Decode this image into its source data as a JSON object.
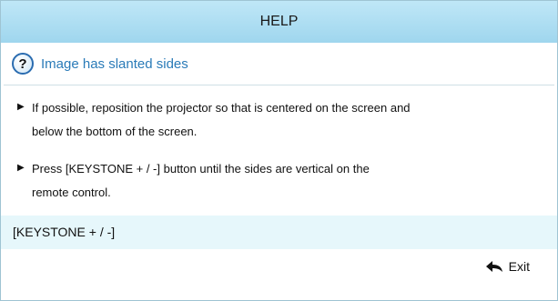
{
  "header": {
    "title": "HELP"
  },
  "topic": {
    "icon": "question-icon",
    "icon_glyph": "?",
    "text": "Image has slanted sides"
  },
  "steps": [
    {
      "line1": "If possible, reposition the projector so that is centered on the screen and",
      "line2": "below the bottom of the screen."
    },
    {
      "line1": "Press [KEYSTONE + / -] button until the sides are vertical on the",
      "line2": "remote control."
    }
  ],
  "keystone": {
    "label": "[KEYSTONE + / -]"
  },
  "footer": {
    "exit_icon": "back-arrow-icon",
    "exit_label": "Exit"
  },
  "colors": {
    "title_bar": "#a9dbf1",
    "topic_text": "#2a7bb8",
    "keystone_bar": "#e6f7fb"
  }
}
